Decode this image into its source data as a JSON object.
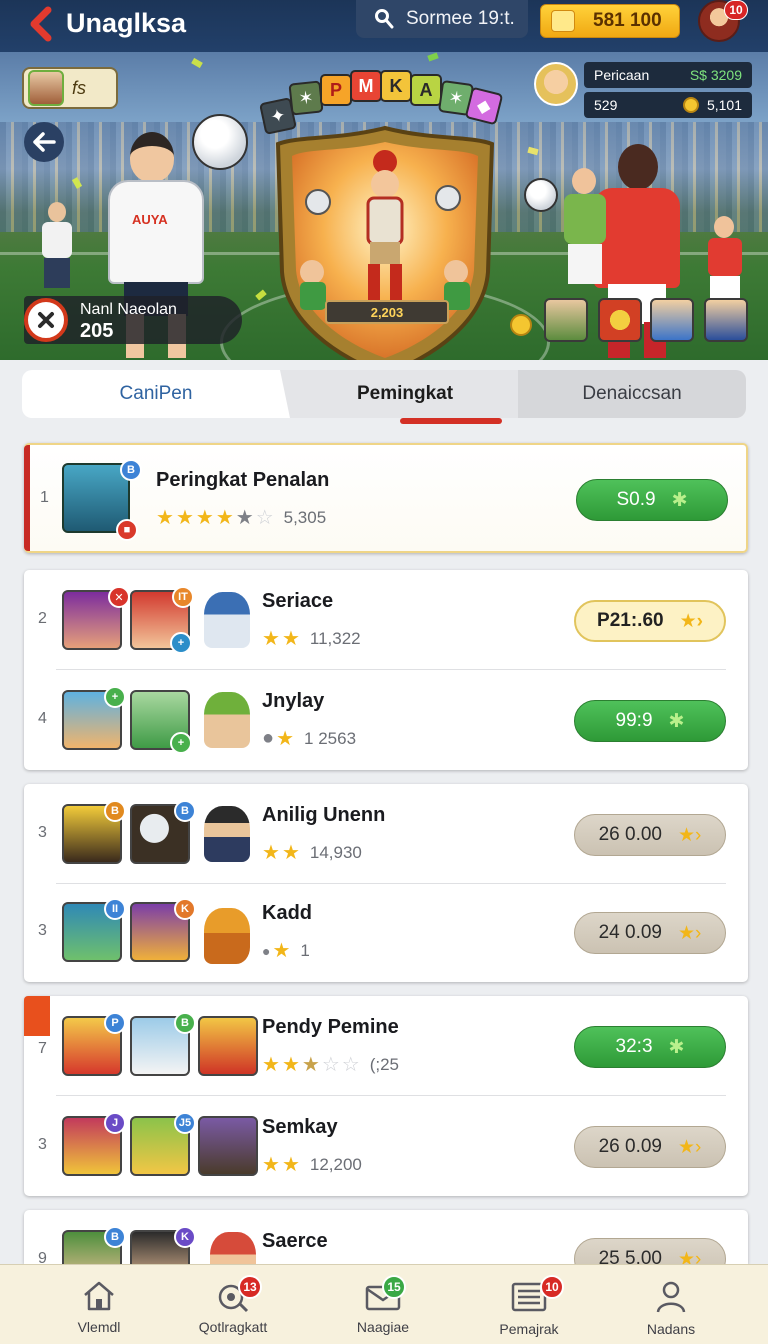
{
  "header": {
    "title": "Unaglksa",
    "search_label": "Sormee 19:t.",
    "coins": "581 100",
    "avatar_badge": "10"
  },
  "hero": {
    "profile_tag": "fs",
    "stats_name": "Pericaan",
    "stats_value1": "S$ 3209",
    "stats_left": "529",
    "stats_value2": "5,101",
    "shield_score": "2,203",
    "shirt_text": "AUYA",
    "footer_name": "Nanl Naeolan",
    "footer_value": "205",
    "letter_tiles": [
      "P",
      "M",
      "K",
      "A"
    ]
  },
  "tabs": [
    {
      "label": "CaniPen"
    },
    {
      "label": "Pemingkat"
    },
    {
      "label": "Denaiccsan"
    }
  ],
  "rows": [
    {
      "rank": "1",
      "name": "Peringkat Penalan",
      "stars_filled": 4,
      "stars_gray": 1.5,
      "score": "5,305",
      "button": "S0.9",
      "button_style": "green",
      "badges": [
        "B"
      ]
    },
    {
      "rank": "2",
      "name": "Seriace",
      "stars_filled": 2,
      "score": "11,322",
      "button": "P21:.60",
      "button_style": "cream",
      "badges": [
        "✕",
        "IT"
      ]
    },
    {
      "rank": "4",
      "name": "Jnylay",
      "stars_filled": 1,
      "score": "1 2563",
      "button": "99:9",
      "button_style": "green",
      "badges": [
        "+",
        "+"
      ]
    },
    {
      "rank": "3",
      "name": "Anilig Unenn",
      "stars_filled": 2,
      "score": "14,930",
      "button": "26 0.00",
      "button_style": "tan",
      "badges": [
        "B",
        "B"
      ]
    },
    {
      "rank": "3",
      "name": "Kadd",
      "stars_filled": 1,
      "score": "1",
      "button": "24 0.09",
      "button_style": "tan",
      "badges": [
        "II",
        "K"
      ]
    },
    {
      "rank": "7",
      "name": "Pendy Pemine",
      "stars_filled": 2.5,
      "stars_empty": 2,
      "score": "(;25",
      "button": "32:3",
      "button_style": "green",
      "badges": [
        "P",
        "B"
      ]
    },
    {
      "rank": "3",
      "name": "Semkay",
      "stars_filled": 2,
      "score": "12,200",
      "button": "26 0.09",
      "button_style": "tan",
      "badges": [
        "J",
        "J5"
      ]
    },
    {
      "rank": "9",
      "name": "Saerce",
      "stars_filled": 0,
      "score": "",
      "button": "25 5.00",
      "button_style": "tan",
      "badges": [
        "B",
        "K"
      ]
    }
  ],
  "bottom_nav": [
    {
      "label": "Vlemdl",
      "icon": "home-icon"
    },
    {
      "label": "Qotlragkatt",
      "icon": "target-icon",
      "badge": "13"
    },
    {
      "label": "Naagiae",
      "icon": "mail-icon",
      "badge": "15"
    },
    {
      "label": "Pemajrak",
      "icon": "trophy-list-icon",
      "badge": "10"
    },
    {
      "label": "Nadans",
      "icon": "user-icon"
    }
  ],
  "colors": {
    "header_bg": "#1c3558",
    "accent_red": "#d33025",
    "green_button": "#3aae45",
    "star_gold": "#f2b619"
  }
}
